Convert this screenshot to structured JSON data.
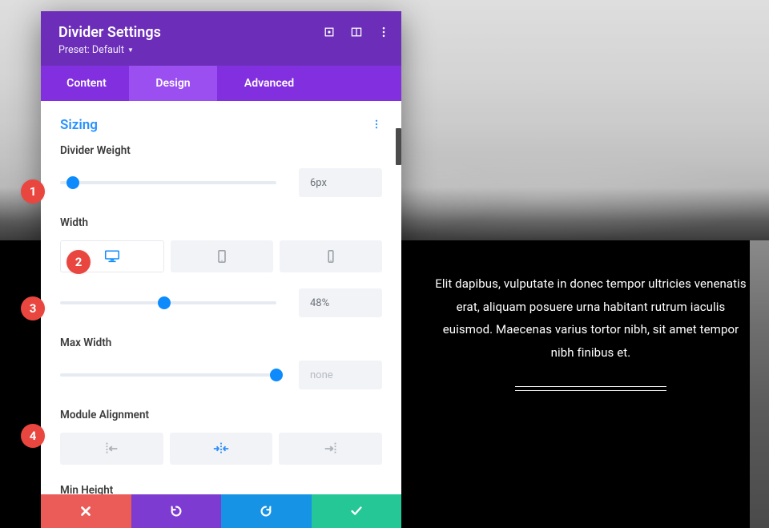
{
  "header": {
    "title": "Divider Settings",
    "preset_label": "Preset: Default"
  },
  "tabs": {
    "content": "Content",
    "design": "Design",
    "advanced": "Advanced"
  },
  "section": {
    "title": "Sizing"
  },
  "fields": {
    "weight": {
      "label": "Divider Weight",
      "value": "6px",
      "slider_pct": 6
    },
    "width": {
      "label": "Width",
      "value": "48%",
      "slider_pct": 48
    },
    "maxwidth": {
      "label": "Max Width",
      "value": "none",
      "slider_pct": 100
    },
    "alignment": {
      "label": "Module Alignment"
    },
    "minheight": {
      "label": "Min Height"
    }
  },
  "preview": {
    "text": "Elit dapibus, vulputate in donec tempor ultricies venenatis erat, aliquam posuere urna habitant rutrum iaculis euismod. Maecenas varius tortor nibh, sit amet tempor nibh finibus et."
  },
  "badges": {
    "b1": "1",
    "b2": "2",
    "b3": "3",
    "b4": "4"
  }
}
